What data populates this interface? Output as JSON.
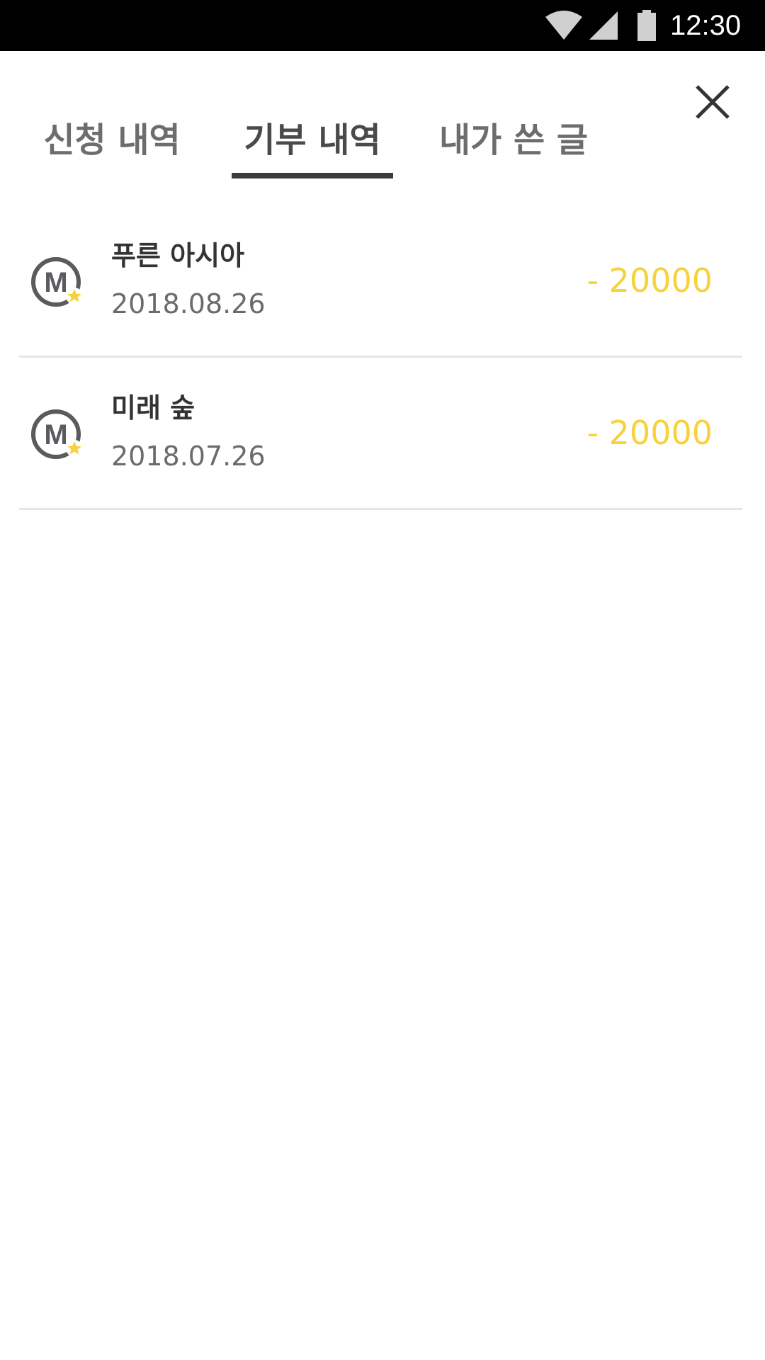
{
  "status_bar": {
    "time": "12:30",
    "icons": [
      "wifi-icon",
      "cell-signal-icon",
      "battery-icon"
    ]
  },
  "header": {
    "close_icon": "close-icon"
  },
  "tabs": [
    {
      "label": "신청 내역",
      "active": false
    },
    {
      "label": "기부 내역",
      "active": true
    },
    {
      "label": "내가 쓴 글",
      "active": false
    }
  ],
  "donations": [
    {
      "name": "푸른 아시아",
      "date": "2018.08.26",
      "amount": "- 20000",
      "icon": "m-star-logo-icon"
    },
    {
      "name": "미래 숲",
      "date": "2018.07.26",
      "amount": "- 20000",
      "icon": "m-star-logo-icon"
    }
  ],
  "colors": {
    "accent": "#f7d23b",
    "tab_indicator": "#3b3b3b",
    "status_bar": "#000000",
    "divider": "#e6e6e6"
  }
}
